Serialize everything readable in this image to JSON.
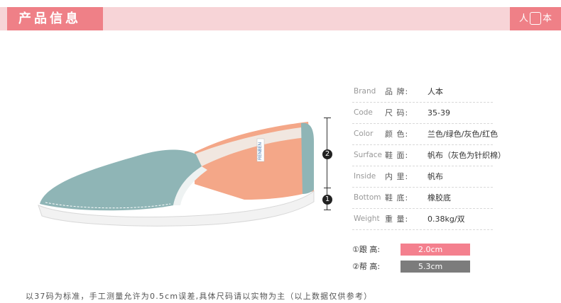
{
  "header": {
    "title": "产品信息",
    "logo_left": "人",
    "logo_right": "本"
  },
  "markers": [
    {
      "label": "2",
      "name": "marker-2"
    },
    {
      "label": "1",
      "name": "marker-1"
    }
  ],
  "specs": [
    {
      "en": "Brand",
      "cn": "品  牌:",
      "value": "人本"
    },
    {
      "en": "Code",
      "cn": "尺  码:",
      "value": "35-39"
    },
    {
      "en": "Color",
      "cn": "颜  色:",
      "value": "兰色/绿色/灰色/红色"
    },
    {
      "en": "Surface",
      "cn": "鞋  面:",
      "value": "帆布（灰色为针织棉）"
    },
    {
      "en": "Inside",
      "cn": "内  里:",
      "value": "帆布"
    },
    {
      "en": "Bottom",
      "cn": "鞋  底:",
      "value": "橡胶底"
    },
    {
      "en": "Weight",
      "cn": "重  量:",
      "value": "0.38kg/双"
    }
  ],
  "measurements": [
    {
      "label": "①跟    高:",
      "value": "2.0cm",
      "color": "#f4808e"
    },
    {
      "label": "②帮    高:",
      "value": "5.3cm",
      "color": "#7c7c7c"
    }
  ],
  "shoe_label": "RENBEN",
  "footnote": "以37码为标准，手工测量允许为0.5cm误差,具体尺码请以实物为主（以上数据仅供参考）",
  "colors": {
    "accent": "#ef8087",
    "header_band": "#f7d4d7",
    "shoe_teal": "#8fb5b6",
    "shoe_peach": "#f4a788"
  }
}
